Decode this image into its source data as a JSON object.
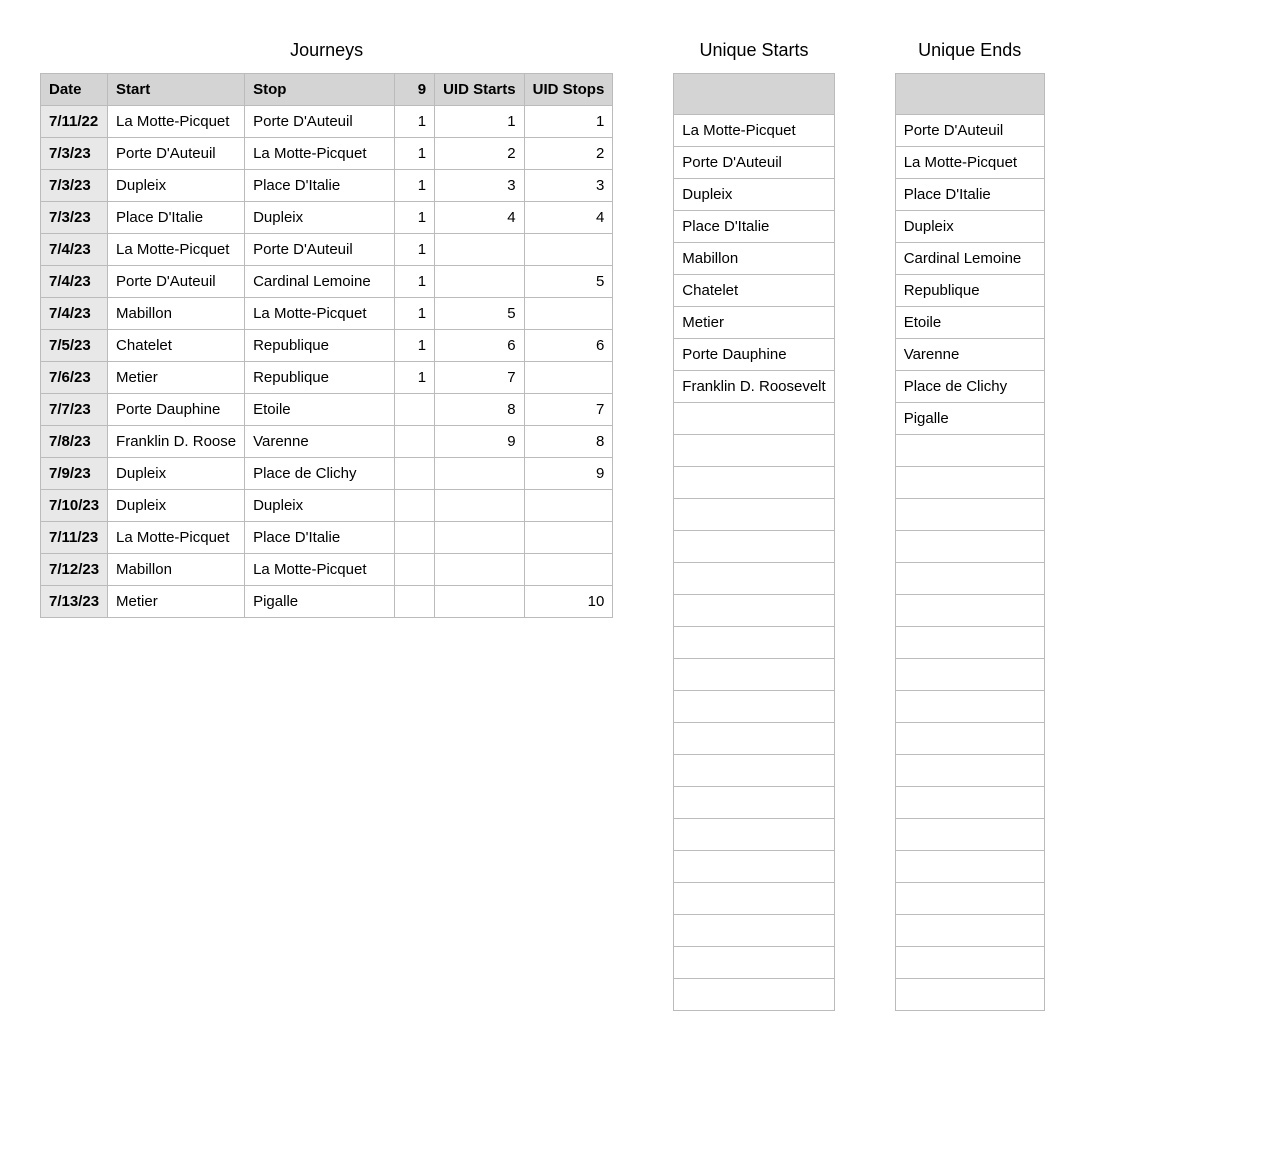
{
  "journeys": {
    "title": "Journeys",
    "headers": {
      "date": "Date",
      "start": "Start",
      "stop": "Stop",
      "count": "9",
      "uid_starts": "UID Starts",
      "uid_stops": "UID Stops"
    },
    "rows": [
      {
        "date": "7/11/22",
        "start": "La Motte-Picquet",
        "stop": "Porte D'Auteuil",
        "count": "1",
        "uid_starts": "1",
        "uid_stops": "1"
      },
      {
        "date": "7/3/23",
        "start": "Porte D'Auteuil",
        "stop": "La Motte-Picquet",
        "count": "1",
        "uid_starts": "2",
        "uid_stops": "2"
      },
      {
        "date": "7/3/23",
        "start": "Dupleix",
        "stop": "Place D'Italie",
        "count": "1",
        "uid_starts": "3",
        "uid_stops": "3"
      },
      {
        "date": "7/3/23",
        "start": "Place D'Italie",
        "stop": "Dupleix",
        "count": "1",
        "uid_starts": "4",
        "uid_stops": "4"
      },
      {
        "date": "7/4/23",
        "start": "La Motte-Picquet",
        "stop": "Porte D'Auteuil",
        "count": "1",
        "uid_starts": "",
        "uid_stops": ""
      },
      {
        "date": "7/4/23",
        "start": "Porte D'Auteuil",
        "stop": "Cardinal Lemoine",
        "count": "1",
        "uid_starts": "",
        "uid_stops": "5"
      },
      {
        "date": "7/4/23",
        "start": "Mabillon",
        "stop": "La Motte-Picquet",
        "count": "1",
        "uid_starts": "5",
        "uid_stops": ""
      },
      {
        "date": "7/5/23",
        "start": "Chatelet",
        "stop": "Republique",
        "count": "1",
        "uid_starts": "6",
        "uid_stops": "6"
      },
      {
        "date": "7/6/23",
        "start": "Metier",
        "stop": "Republique",
        "count": "1",
        "uid_starts": "7",
        "uid_stops": ""
      },
      {
        "date": "7/7/23",
        "start": "Porte Dauphine",
        "stop": "Etoile",
        "count": "",
        "uid_starts": "8",
        "uid_stops": "7"
      },
      {
        "date": "7/8/23",
        "start": "Franklin D. Roose",
        "stop": "Varenne",
        "count": "",
        "uid_starts": "9",
        "uid_stops": "8"
      },
      {
        "date": "7/9/23",
        "start": "Dupleix",
        "stop": "Place de Clichy",
        "count": "",
        "uid_starts": "",
        "uid_stops": "9"
      },
      {
        "date": "7/10/23",
        "start": "Dupleix",
        "stop": "Dupleix",
        "count": "",
        "uid_starts": "",
        "uid_stops": ""
      },
      {
        "date": "7/11/23",
        "start": "La Motte-Picquet",
        "stop": "Place D'Italie",
        "count": "",
        "uid_starts": "",
        "uid_stops": ""
      },
      {
        "date": "7/12/23",
        "start": "Mabillon",
        "stop": "La Motte-Picquet",
        "count": "",
        "uid_starts": "",
        "uid_stops": ""
      },
      {
        "date": "7/13/23",
        "start": "Metier",
        "stop": "Pigalle",
        "count": "",
        "uid_starts": "",
        "uid_stops": "10"
      }
    ]
  },
  "unique_starts": {
    "title": "Unique Starts",
    "items": [
      "La Motte-Picquet",
      "Porte D'Auteuil",
      "Dupleix",
      "Place D'Italie",
      "Mabillon",
      "Chatelet",
      "Metier",
      "Porte Dauphine",
      "Franklin D. Roosevelt"
    ],
    "total_rows": 28
  },
  "unique_ends": {
    "title": "Unique Ends",
    "items": [
      "Porte D'Auteuil",
      "La Motte-Picquet",
      "Place D'Italie",
      "Dupleix",
      "Cardinal Lemoine",
      "Republique",
      "Etoile",
      "Varenne",
      "Place de Clichy",
      "Pigalle"
    ],
    "total_rows": 28
  }
}
